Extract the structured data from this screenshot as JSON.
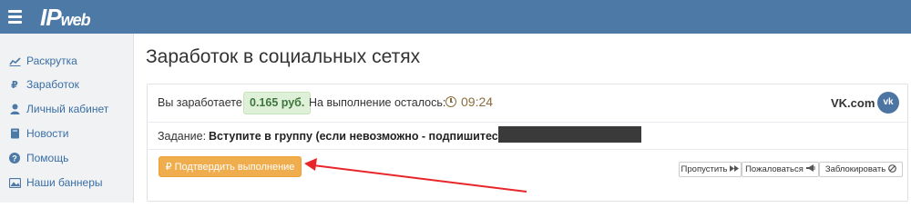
{
  "header": {
    "logo_text": "IP",
    "logo_suffix": "web",
    "colors": {
      "bar": "#4c79a6"
    }
  },
  "sidebar": {
    "items": [
      {
        "label": "Раскрутка",
        "icon": "line-chart-icon"
      },
      {
        "label": "Заработок",
        "icon": "ruble-icon"
      },
      {
        "label": "Личный кабинет",
        "icon": "user-icon"
      },
      {
        "label": "Новости",
        "icon": "book-icon"
      },
      {
        "label": "Помощь",
        "icon": "question-circle-icon"
      },
      {
        "label": "Наши баннеры",
        "icon": "image-icon"
      }
    ]
  },
  "main": {
    "title": "Заработок в социальных сетях",
    "task": {
      "earn_label": "Вы заработаете:",
      "earn_amount": "0.165 руб.",
      "remaining_label": "На выполнение осталось:",
      "timer": "09:24",
      "network": "VK.com",
      "network_icon": "vk-icon",
      "task_label": "Задание:",
      "task_text": "Вступите в группу (если невозможно - подпишитесь)",
      "confirm_label": "Подтвердить выполнение",
      "skip_label": "Пропустить",
      "report_label": "Пожаловаться",
      "block_label": "Заблокировать"
    },
    "colors": {
      "accent_orange": "#f0ad4e",
      "success_bg": "#dff0d8",
      "success_text": "#3c763d",
      "timer": "#8a6d3b",
      "annotation_arrow": "#e8262a"
    }
  }
}
